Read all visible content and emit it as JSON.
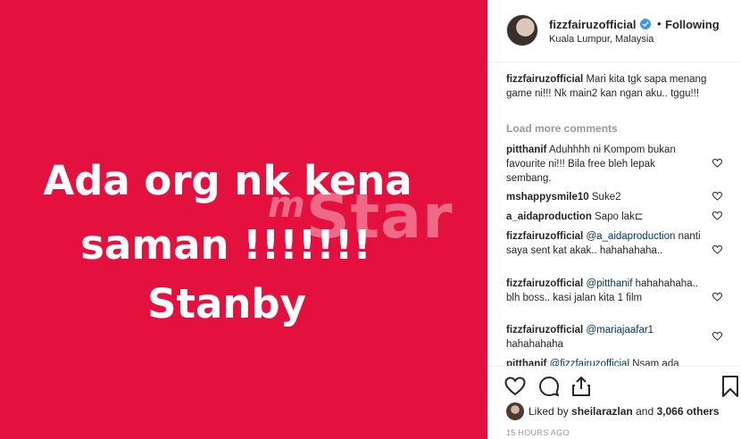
{
  "media": {
    "lines": [
      "Ada org nk kena",
      "saman !!!!!!!",
      "Stanby"
    ],
    "watermark": "Star",
    "background_color": "#e4103e"
  },
  "header": {
    "username": "fizzfairuzofficial",
    "separator": "•",
    "following_label": "Following",
    "location": "Kuala Lumpur, Malaysia"
  },
  "caption": {
    "username": "fizzfairuzofficial",
    "text": "Mari kita tgk sapa menang game ni!!! Nk main2 kan ngan aku.. tggu!!!"
  },
  "load_more_label": "Load more comments",
  "comments": [
    {
      "username": "pitthanif",
      "mention": "",
      "text": "Aduhhhh ni Kompom bukan favourite ni!!! Bila free bleh lepak sembang."
    },
    {
      "username": "mshappysmile10",
      "mention": "",
      "text": "Suke2"
    },
    {
      "username": "a_aidaproduction",
      "mention": "",
      "text": "Sapo lak⊏"
    },
    {
      "username": "fizzfairuzofficial",
      "mention": "@a_aidaproduction",
      "text": "nanti saya sent kat akak.. hahahahaha.."
    },
    {
      "username": "fizzfairuzofficial",
      "mention": "@pitthanif",
      "text": "hahahahaha.. blh boss.. kasi jalan kita 1 film"
    },
    {
      "username": "fizzfairuzofficial",
      "mention": "@mariajaafar1",
      "text": "hahahahaha"
    },
    {
      "username": "pitthanif",
      "mention": "@fizzfairuzofficial",
      "text": "Nsam ada"
    }
  ],
  "likes": {
    "prefix": "Liked by",
    "user": "sheilarazlan",
    "connector": "and",
    "others": "3,066 others"
  },
  "timestamp": "15 HOURS AGO",
  "icons": {
    "like": "heart-icon",
    "comment": "comment-icon",
    "share": "share-icon",
    "save": "bookmark-icon",
    "verified": "verified-badge-icon"
  },
  "colors": {
    "accent_blue": "#3897f0",
    "mention_blue": "#003569",
    "muted": "#999999"
  }
}
